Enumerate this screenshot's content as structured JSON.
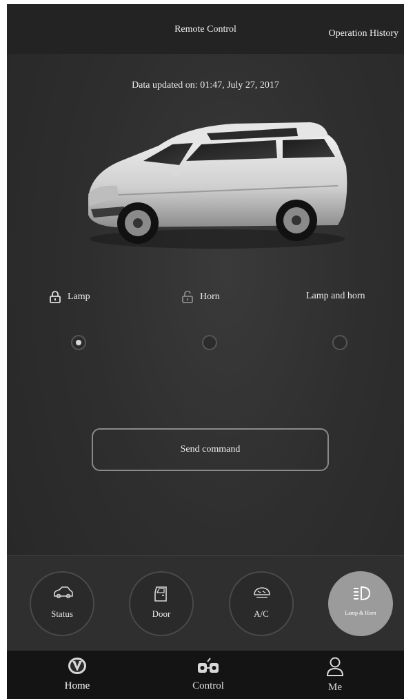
{
  "header": {
    "title": "Remote Control",
    "history_label": "Operation History"
  },
  "status": {
    "updated_text": "Data updated on: 01:47, July 27, 2017"
  },
  "options": [
    {
      "label": "Lamp",
      "icon": "lock-closed-icon",
      "selected": true
    },
    {
      "label": "Horn",
      "icon": "lock-open-icon",
      "selected": false
    },
    {
      "label": "Lamp and horn",
      "icon": "",
      "selected": false
    }
  ],
  "send_label": "Send command",
  "modes": [
    {
      "label": "Status",
      "icon": "car-icon",
      "active": false
    },
    {
      "label": "Door",
      "icon": "door-icon",
      "active": false
    },
    {
      "label": "A/C",
      "icon": "ac-icon",
      "active": false
    },
    {
      "label": "Lamp & Horn",
      "icon": "headlight-icon",
      "active": true
    }
  ],
  "nav": [
    {
      "label": "Home",
      "icon": "brand-logo-icon",
      "active": true
    },
    {
      "label": "Control",
      "icon": "remote-control-icon",
      "active": false
    },
    {
      "label": "Me",
      "icon": "person-icon",
      "active": false
    }
  ],
  "colors": {
    "background": "#2e2e2e",
    "topbar": "#232323",
    "nav_bar": "#141414",
    "active_mode": "#9b9b9b"
  }
}
